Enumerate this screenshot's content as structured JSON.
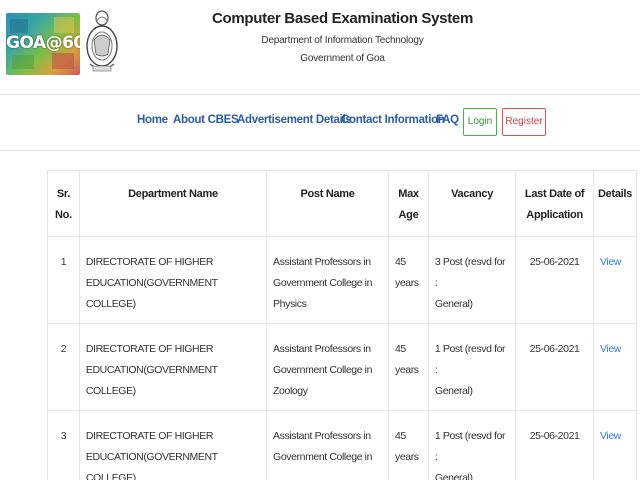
{
  "header": {
    "logo_text": "GOA@60",
    "title": "Computer Based Examination System",
    "department": "Department of Information Technology",
    "government": "Government of Goa"
  },
  "nav": {
    "home": "Home",
    "about": "About CBES",
    "advertisement": "Advertisement Details",
    "contact": "Contact Information",
    "faq": "FAQ",
    "login": "Login",
    "register": "Register"
  },
  "table": {
    "headers": {
      "sr_1": "Sr.",
      "sr_2": "No.",
      "department": "Department Name",
      "post": "Post Name",
      "age_1": "Max",
      "age_2": "Age",
      "vacancy": "Vacancy",
      "date_1": "Last Date of",
      "date_2": "Application",
      "details": "Details"
    },
    "rows": [
      {
        "sr": "1",
        "dept_1": "DIRECTORATE OF HIGHER",
        "dept_2": "EDUCATION(GOVERNMENT COLLEGE)",
        "post_1": "Assistant Professors in",
        "post_2": "Government College in",
        "post_3": "Physics",
        "age_1": "45",
        "age_2": "years",
        "vac_1": "3 Post (resvd for :",
        "vac_2": "General)",
        "date": "25-06-2021",
        "details": "View"
      },
      {
        "sr": "2",
        "dept_1": "DIRECTORATE OF HIGHER",
        "dept_2": "EDUCATION(GOVERNMENT COLLEGE)",
        "post_1": "Assistant Professors in",
        "post_2": "Government College in",
        "post_3": "Zoology",
        "age_1": "45",
        "age_2": "years",
        "vac_1": "1 Post (resvd for :",
        "vac_2": "General)",
        "date": "25-06-2021",
        "details": "View"
      },
      {
        "sr": "3",
        "dept_1": "DIRECTORATE OF HIGHER",
        "dept_2": "EDUCATION(GOVERNMENT COLLEGE)",
        "post_1": "Assistant Professors in",
        "post_2": "Government College in",
        "post_3": "",
        "age_1": "45",
        "age_2": "years",
        "vac_1": "1 Post (resvd for :",
        "vac_2": "General)",
        "date": "25-06-2021",
        "details": "View"
      }
    ]
  },
  "icons": {
    "logo": "goa-at-60-logo",
    "emblem": "government-emblem"
  },
  "colors": {
    "link": "#2b5ca8",
    "login_border": "#4caf50",
    "register_border": "#e05050",
    "view_link": "#2b7fd0"
  }
}
